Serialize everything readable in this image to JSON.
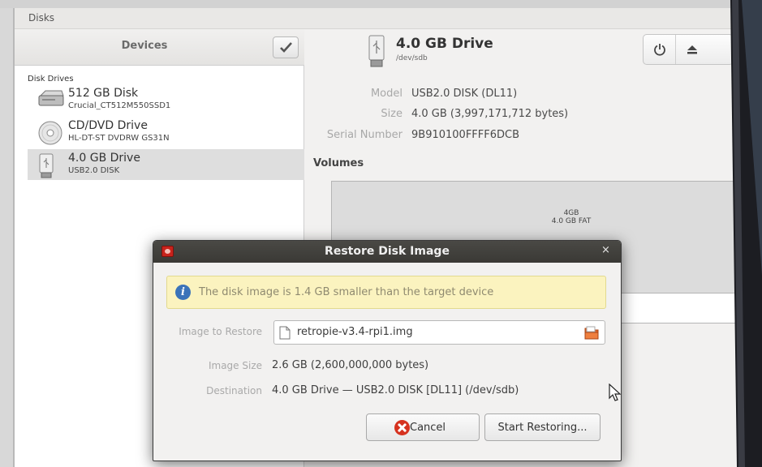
{
  "window": {
    "title": "Disks"
  },
  "sidebar": {
    "header": "Devices",
    "group_label": "Disk Drives",
    "devices": [
      {
        "name": "512 GB Disk",
        "sub": "Crucial_CT512M550SSD1",
        "icon": "hard-disk-icon"
      },
      {
        "name": "CD/DVD Drive",
        "sub": "HL-DT-ST DVDRW  GS31N",
        "icon": "optical-drive-icon"
      },
      {
        "name": "4.0 GB Drive",
        "sub": "USB2.0 DISK",
        "icon": "usb-drive-icon",
        "selected": true
      }
    ]
  },
  "drive": {
    "name": "4.0 GB Drive",
    "device": "/dev/sdb",
    "properties": [
      {
        "key": "Model",
        "value": "USB2.0 DISK (DL11)"
      },
      {
        "key": "Size",
        "value": "4.0 GB (3,997,171,712 bytes)"
      },
      {
        "key": "Serial Number",
        "value": "9B910100FFFF6DCB"
      }
    ],
    "volumes_title": "Volumes",
    "volume": {
      "line1": "4GB",
      "line2": "4.0 GB FAT"
    }
  },
  "dialog": {
    "title": "Restore Disk Image",
    "close": "×",
    "info": "The disk image is 1.4 GB smaller than the target device",
    "image_label": "Image to Restore",
    "image_file": "retropie-v3.4-rpi1.img",
    "size_label": "Image Size",
    "size_value": "2.6 GB (2,600,000,000 bytes)",
    "dest_label": "Destination",
    "dest_value": "4.0 GB Drive — USB2.0 DISK [DL11] (/dev/sdb)",
    "cancel_label": "Cancel",
    "start_label": "Start Restoring..."
  },
  "colors": {
    "dialog_titlebar": "#3a3935",
    "info_bar": "#fbf3bf",
    "info_icon": "#3b73b9",
    "cancel_icon": "#d6321f",
    "folder_icon": "#e0662a"
  }
}
